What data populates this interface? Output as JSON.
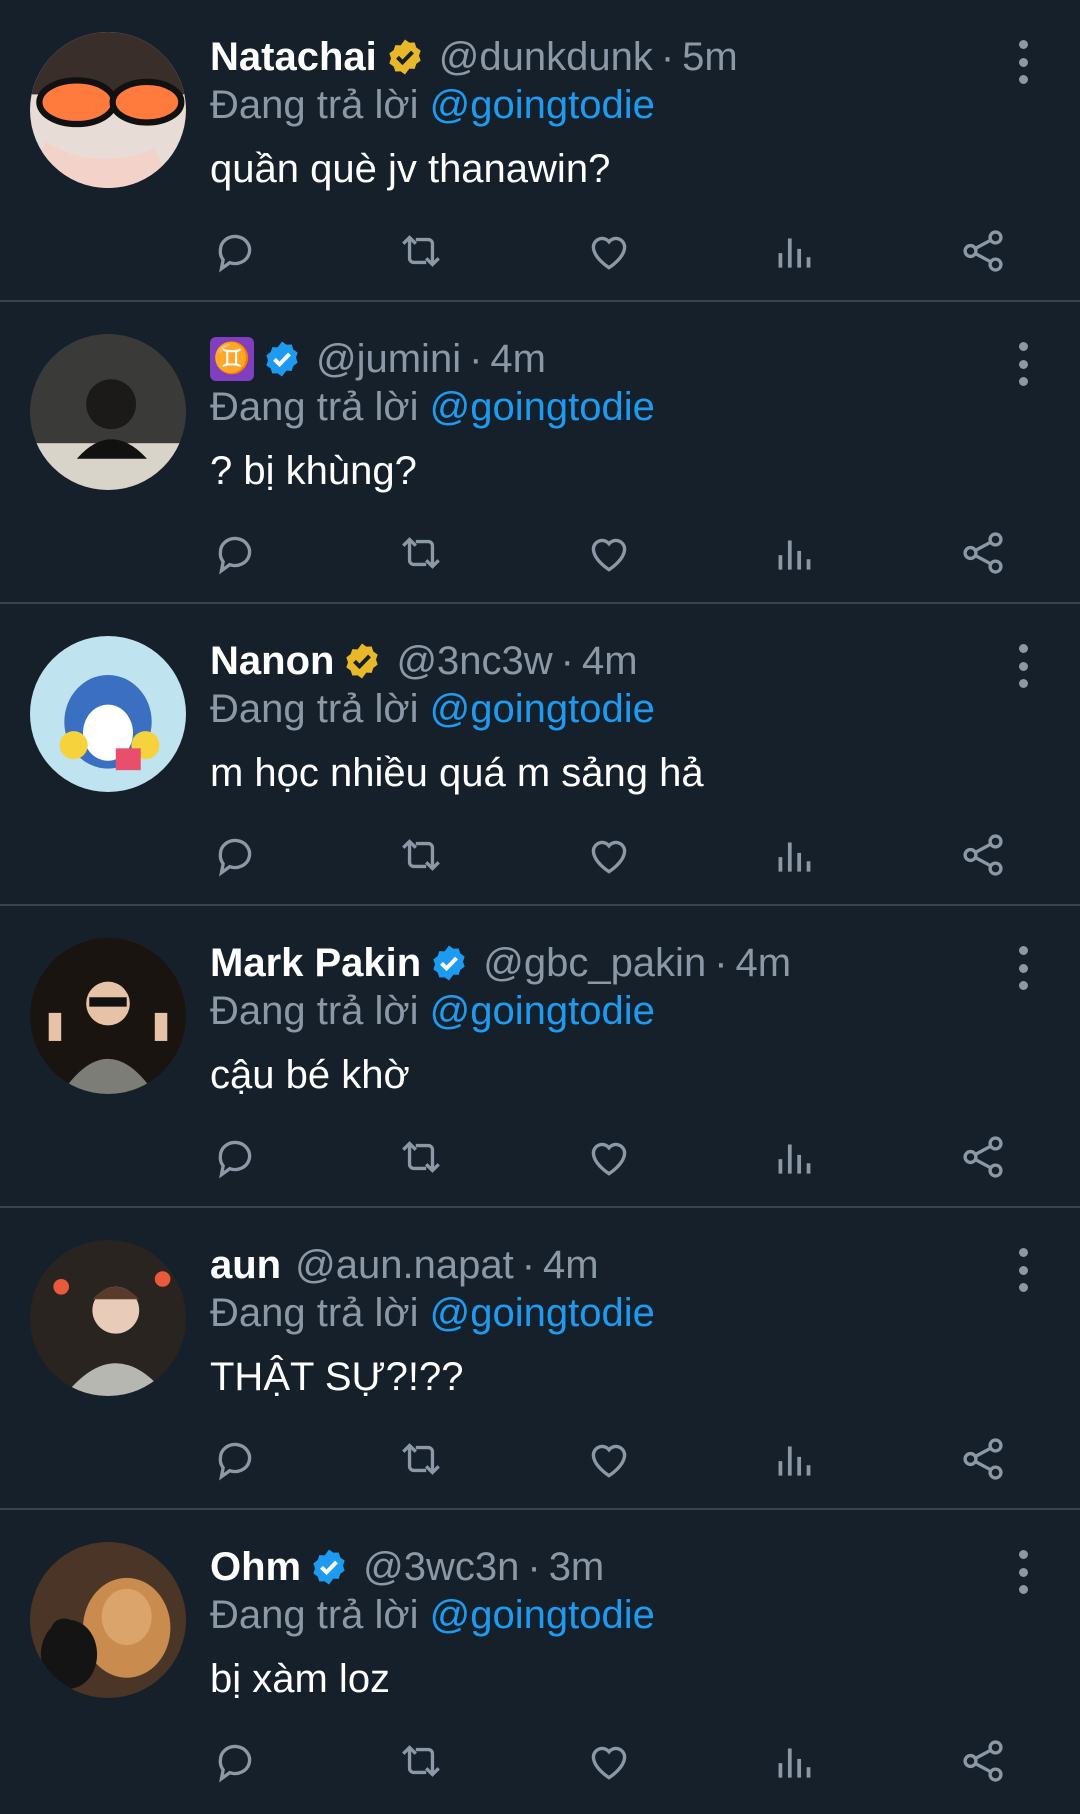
{
  "colors": {
    "background": "#15202b",
    "divider": "#38444d",
    "muted": "#8b98a5",
    "accent": "#1d9bf0",
    "gold_badge": "#e8b829",
    "blue_badge": "#1d9bf0"
  },
  "replying_label": "Đang trả lời",
  "icons": {
    "reply": "reply-icon",
    "retweet": "retweet-icon",
    "like": "heart-icon",
    "views": "views-icon",
    "share": "share-icon",
    "more": "more-icon"
  },
  "tweets": [
    {
      "name": "Natachai",
      "badge": "gold",
      "handle": "@dunkdunk",
      "dot": "·",
      "time": "5m",
      "reply_to": "@goingtodie",
      "text": "quần què jv thanawin?"
    },
    {
      "name": "",
      "emoji": "♊",
      "badge": "blue",
      "handle": "@jumini",
      "dot": "·",
      "time": "4m",
      "reply_to": "@goingtodie",
      "text": "? bị khùng?"
    },
    {
      "name": "Nanon",
      "badge": "gold",
      "handle": "@3nc3w",
      "dot": "·",
      "time": "4m",
      "reply_to": "@goingtodie",
      "text": "m học nhiều quá m sảng hả"
    },
    {
      "name": "Mark Pakin",
      "badge": "blue",
      "handle": "@gbc_pakin",
      "dot": "·",
      "time": "4m",
      "reply_to": "@goingtodie",
      "text": "cậu bé khờ"
    },
    {
      "name": "aun",
      "badge": "none",
      "handle": "@aun.napat",
      "dot": "·",
      "time": "4m",
      "reply_to": "@goingtodie",
      "text": "THẬT SỰ?!??"
    },
    {
      "name": "Ohm",
      "badge": "blue",
      "handle": "@3wc3n",
      "dot": "·",
      "time": "3m",
      "reply_to": "@goingtodie",
      "text": "bị xàm loz"
    }
  ]
}
